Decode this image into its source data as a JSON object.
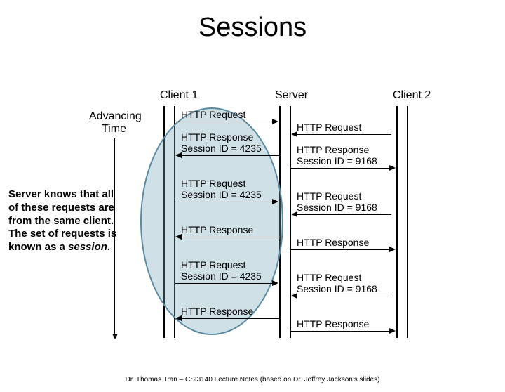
{
  "title": "Sessions",
  "participants": {
    "client1": "Client 1",
    "server": "Server",
    "client2": "Client 2"
  },
  "time_label_1": "Advancing",
  "time_label_2": "Time",
  "side_note_1": "Server knows that all of these requests are from the same client.  The set of requests is known as a ",
  "side_note_2": "session",
  "side_note_3": ".",
  "left_msgs": {
    "m1": "HTTP Request",
    "m2": "HTTP Response",
    "m3": "Session ID = 4235",
    "m4": "HTTP Request",
    "m5": "Session ID = 4235",
    "m6": "HTTP Response",
    "m7": "HTTP Request",
    "m8": "Session ID = 4235",
    "m9": "HTTP Response"
  },
  "right_msgs": {
    "m1": "HTTP Request",
    "m2": "HTTP Response",
    "m3": "Session ID = 9168",
    "m4": "HTTP Request",
    "m5": "Session ID = 9168",
    "m6": "HTTP Response",
    "m7": "HTTP Request",
    "m8": "Session ID = 9168",
    "m9": "HTTP Response"
  },
  "footer": "Dr. Thomas Tran – CSI3140 Lecture Notes (based on Dr. Jeffrey Jackson's slides)"
}
